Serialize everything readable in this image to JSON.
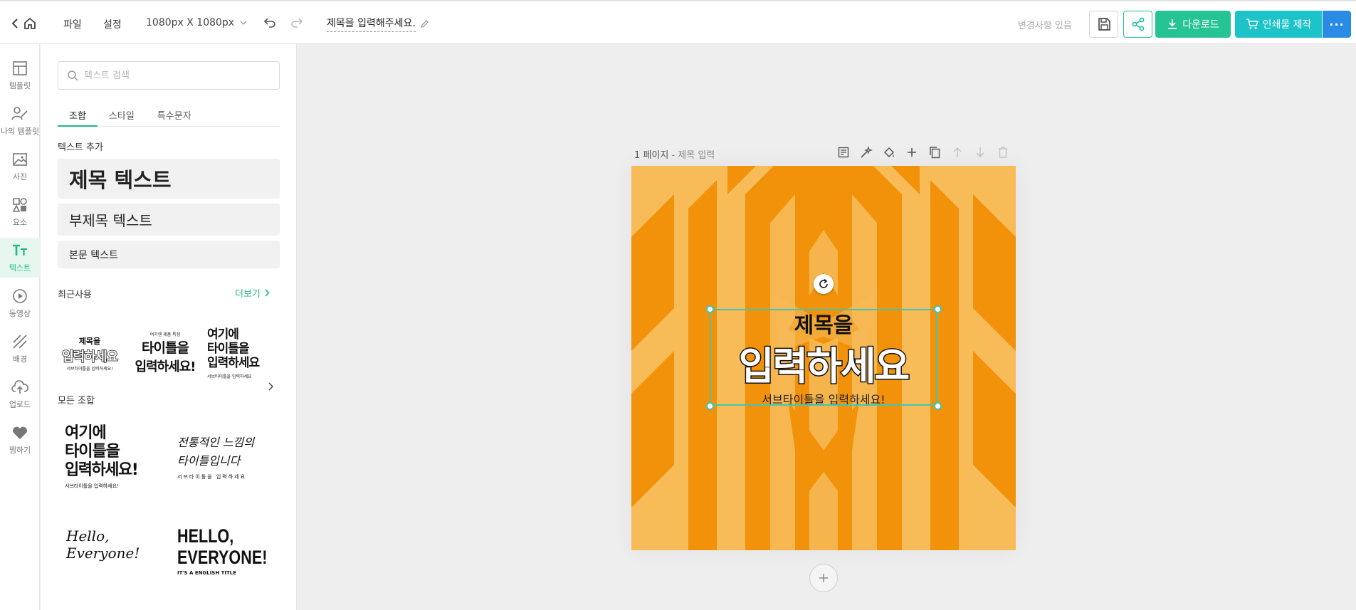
{
  "topbar": {
    "file": "파일",
    "settings": "설정",
    "size": "1080px X 1080px",
    "doc_title": "제목을 입력해주세요.",
    "unsaved": "변경사항 있음",
    "download": "다운로드",
    "print": "인쇄물 제작"
  },
  "rail": [
    {
      "label": "템플릿",
      "icon": "template-icon"
    },
    {
      "label": "나의 템플릿",
      "icon": "my-template-icon"
    },
    {
      "label": "사진",
      "icon": "photo-icon"
    },
    {
      "label": "요소",
      "icon": "elements-icon"
    },
    {
      "label": "텍스트",
      "icon": "text-icon"
    },
    {
      "label": "동영상",
      "icon": "video-icon"
    },
    {
      "label": "배경",
      "icon": "background-icon"
    },
    {
      "label": "업로드",
      "icon": "upload-icon"
    },
    {
      "label": "찜하기",
      "icon": "heart-icon"
    }
  ],
  "panel": {
    "search_placeholder": "텍스트 검색",
    "tabs": [
      "조합",
      "스타일",
      "특수문자"
    ],
    "add_text_title": "텍스트 추가",
    "title_text": "제목 텍스트",
    "subtitle_text": "부제목 텍스트",
    "body_text": "본문 텍스트",
    "recent_title": "최근사용",
    "more": "더보기",
    "recent": [
      {
        "line1": "제목을",
        "line2": "입력하세요",
        "line3": "서브타이틀을 입력하세요!"
      },
      {
        "line1": "여기엔 제품 특징",
        "line2": "타이틀을",
        "line3": "입력하세요!"
      },
      {
        "line1": "여기에",
        "line2": "타이틀을",
        "line3": "입력하세요",
        "line4": "서브타이틀을 입력하세요"
      }
    ],
    "all_title": "모든 조합",
    "all": [
      {
        "line1": "여기에",
        "line2": "타이틀을",
        "line3": "입력하세요!",
        "line4": "서브타이틀을 입력하세요!"
      },
      {
        "line1": "전통적인 느낌의",
        "line2": "타이틀입니다",
        "line3": "서브타이틀을 입력하세요"
      },
      {
        "line1": "Hello,",
        "line2": "Everyone!"
      },
      {
        "line1": "HELLO,",
        "line2": "EVERYONE!",
        "line3": "IT'S A ENGLISH TITLE"
      }
    ]
  },
  "canvas": {
    "page_label": "1 페이지",
    "page_sub": "- 제목 입력",
    "title1": "제목을",
    "title2": "입력하세요",
    "subtitle": "서브타이틀을 입력하세요!"
  },
  "colors": {
    "accent": "#1fb985",
    "download": "#27c493",
    "print": "#1cc3c8",
    "more": "#2a8be5",
    "design_dark": "#f1920a",
    "design_light": "#f7bb58"
  }
}
